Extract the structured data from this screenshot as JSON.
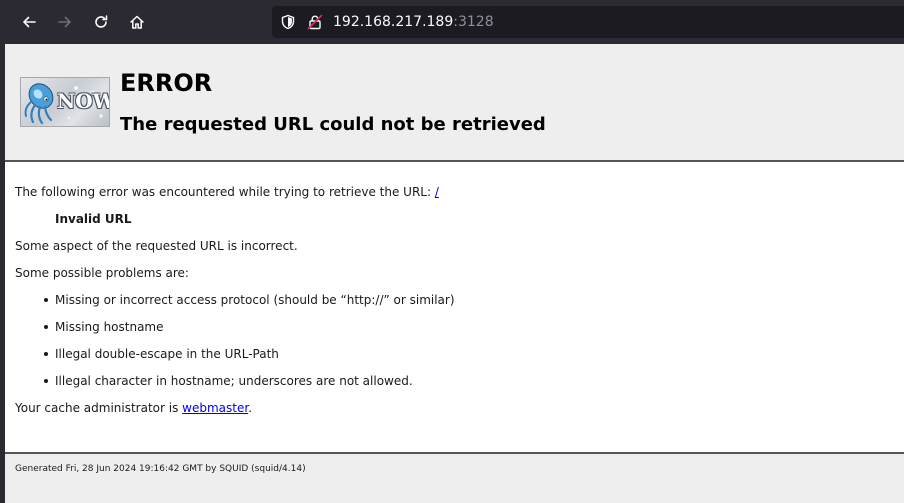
{
  "browser": {
    "url_host": "192.168.217.189",
    "url_port": ":3128",
    "icons": [
      "back-icon",
      "forward-icon",
      "reload-icon",
      "home-icon",
      "shield-icon",
      "insecure-lock-icon"
    ]
  },
  "error_page": {
    "logo_text": "NOW",
    "title": "ERROR",
    "subtitle": "The requested URL could not be retrieved",
    "intro_text": "The following error was encountered while trying to retrieve the URL: ",
    "url_link": "/",
    "error_name": "Invalid URL",
    "description": "Some aspect of the requested URL is incorrect.",
    "problems_heading": "Some possible problems are:",
    "problems": [
      "Missing or incorrect access protocol (should be “http://” or similar)",
      "Missing hostname",
      "Illegal double-escape in the URL-Path",
      "Illegal character in hostname; underscores are not allowed."
    ],
    "admin_text": "Your cache administrator is ",
    "admin_link": "webmaster",
    "admin_suffix": ".",
    "footer": "Generated Fri, 28 Jun 2024 19:16:42 GMT by SQUID (squid/4.14)"
  },
  "colors": {
    "toolbar_bg": "#2b2a33",
    "urlbar_bg": "#1c1b22",
    "page_header_bg": "#eeeeee",
    "link": "#0000ee",
    "insecure_lock": "#e22850"
  }
}
